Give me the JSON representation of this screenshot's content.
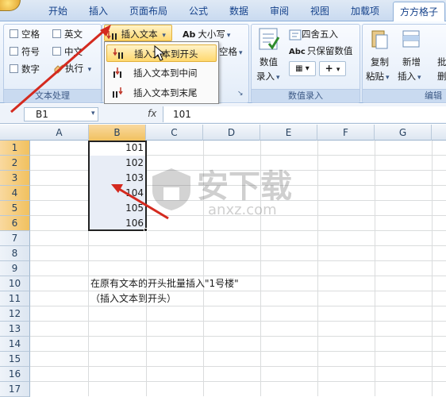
{
  "ribbon_tabs": [
    "开始",
    "插入",
    "页面布局",
    "公式",
    "数据",
    "审阅",
    "视图",
    "加载项",
    "方方格子"
  ],
  "groups": {
    "text_processing": {
      "title": "文本处理",
      "checkboxes": [
        "空格",
        "英文",
        "符号",
        "中文",
        "数字"
      ],
      "execute_label": "执行"
    },
    "insert_text_label": "插入文本",
    "case_label": "大小写",
    "case_icon_text": "Ab",
    "partial_label": "空格",
    "numeric_entry": {
      "title": "数值录入",
      "value_label": "数值",
      "entry_label": "录入",
      "round_label": "四舍五入",
      "keep_value_label": "只保留数值",
      "keep_value_icon_text": "Abc",
      "plus_symbol": "+"
    },
    "edit": {
      "title": "编辑",
      "copy_label": "复制",
      "paste_label": "粘贴",
      "new_label": "新增",
      "insert_label": "插入",
      "partial_label": "批",
      "delete_partial": "删"
    }
  },
  "insert_menu": {
    "items": [
      "插入文本到开头",
      "插入文本到中间",
      "插入文本到末尾"
    ],
    "highlighted_index": 0
  },
  "formula_bar": {
    "name_box": "B1",
    "fx": "fx",
    "formula": "101"
  },
  "sheet": {
    "columns": [
      "A",
      "B",
      "C",
      "D",
      "E",
      "F",
      "G"
    ],
    "rows": [
      "1",
      "2",
      "3",
      "4",
      "5",
      "6",
      "7",
      "8",
      "9",
      "10",
      "11",
      "12",
      "13",
      "14",
      "15",
      "16",
      "17"
    ],
    "b_values": [
      "101",
      "102",
      "103",
      "104",
      "105",
      "106"
    ],
    "note_line1": "在原有文本的开头批量插入\"1号楼\"",
    "note_line2": "（插入文本到开头）"
  },
  "watermark_text": "安下载",
  "watermark_sub": "anxz.com",
  "colors": {
    "tab_text": "#15428b",
    "arrow": "#d42a1f",
    "selection_header": "#f1c15f"
  }
}
